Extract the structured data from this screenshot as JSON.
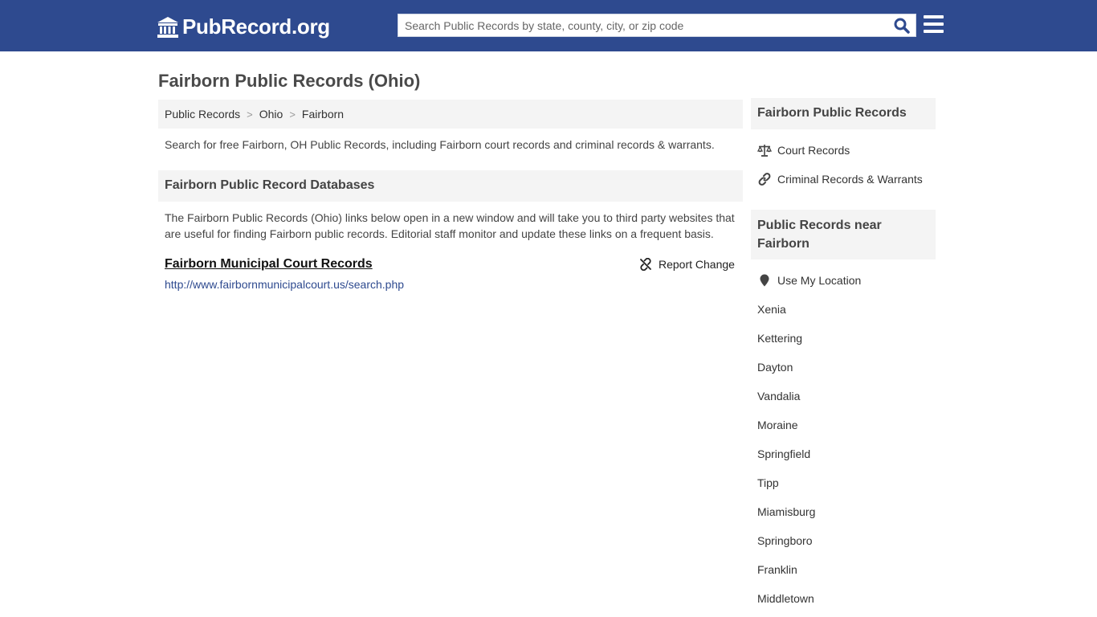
{
  "header": {
    "logo_text": "PubRecord.org",
    "search_placeholder": "Search Public Records by state, county, city, or zip code",
    "search_value": ""
  },
  "main": {
    "title": "Fairborn Public Records (Ohio)",
    "breadcrumb": [
      {
        "label": "Public Records"
      },
      {
        "label": "Ohio"
      },
      {
        "label": "Fairborn"
      }
    ],
    "breadcrumb_separator": ">",
    "intro": "Search for free Fairborn, OH Public Records, including Fairborn court records and criminal records & warrants.",
    "section_title": "Fairborn Public Record Databases",
    "section_description": "The Fairborn Public Records (Ohio) links below open in a new window and will take you to third party websites that are useful for finding Fairborn public records. Editorial staff monitor and update these links on a frequent basis.",
    "records": [
      {
        "title": "Fairborn Municipal Court Records",
        "url": "http://www.fairbornmunicipalcourt.us/search.php",
        "report_label": "Report Change"
      }
    ]
  },
  "sidebar": {
    "box1_title": "Fairborn Public Records",
    "links": [
      {
        "label": "Court Records",
        "icon": "balance-scale-icon"
      },
      {
        "label": "Criminal Records & Warrants",
        "icon": "link-icon"
      }
    ],
    "box2_title": "Public Records near Fairborn",
    "use_location_label": "Use My Location",
    "location_icon": "map-pin-icon",
    "nearby_cities": [
      "Xenia",
      "Kettering",
      "Dayton",
      "Vandalia",
      "Moraine",
      "Springfield",
      "Tipp",
      "Miamisburg",
      "Springboro",
      "Franklin",
      "Middletown"
    ]
  },
  "colors": {
    "header_bg": "#2e4a8f",
    "panel_bg": "#f4f4f4",
    "link": "#2e4a8f",
    "search_icon": "#2e4a8f"
  }
}
